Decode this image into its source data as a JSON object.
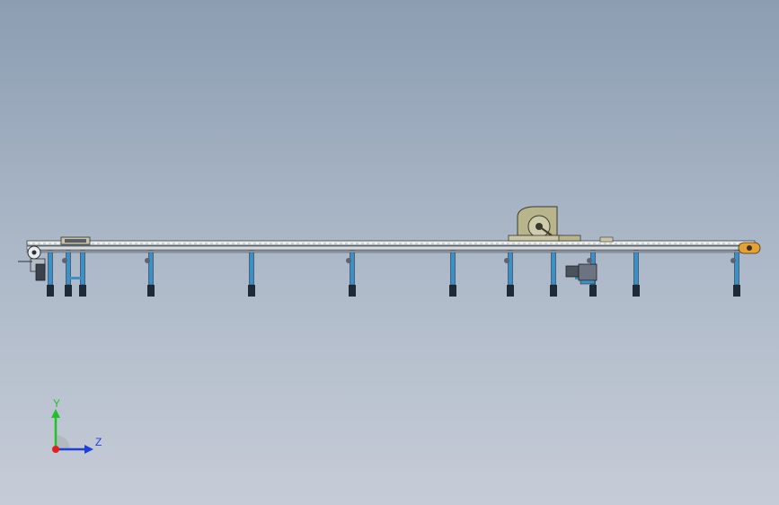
{
  "viewport": {
    "background_top": "#8c9db2",
    "background_bottom": "#c6ccd7"
  },
  "model": {
    "frame_color": "#eef0ee",
    "leg_color": "#3f8fc2",
    "foot_color": "#1f2a38",
    "saw_color": "#b8b48c",
    "accent_color": "#e5a233"
  },
  "triad": {
    "y_label": "Y",
    "z_label": "Z",
    "y_color": "#22c02a",
    "z_color": "#1f3fd8",
    "x_color": "#e02020"
  }
}
